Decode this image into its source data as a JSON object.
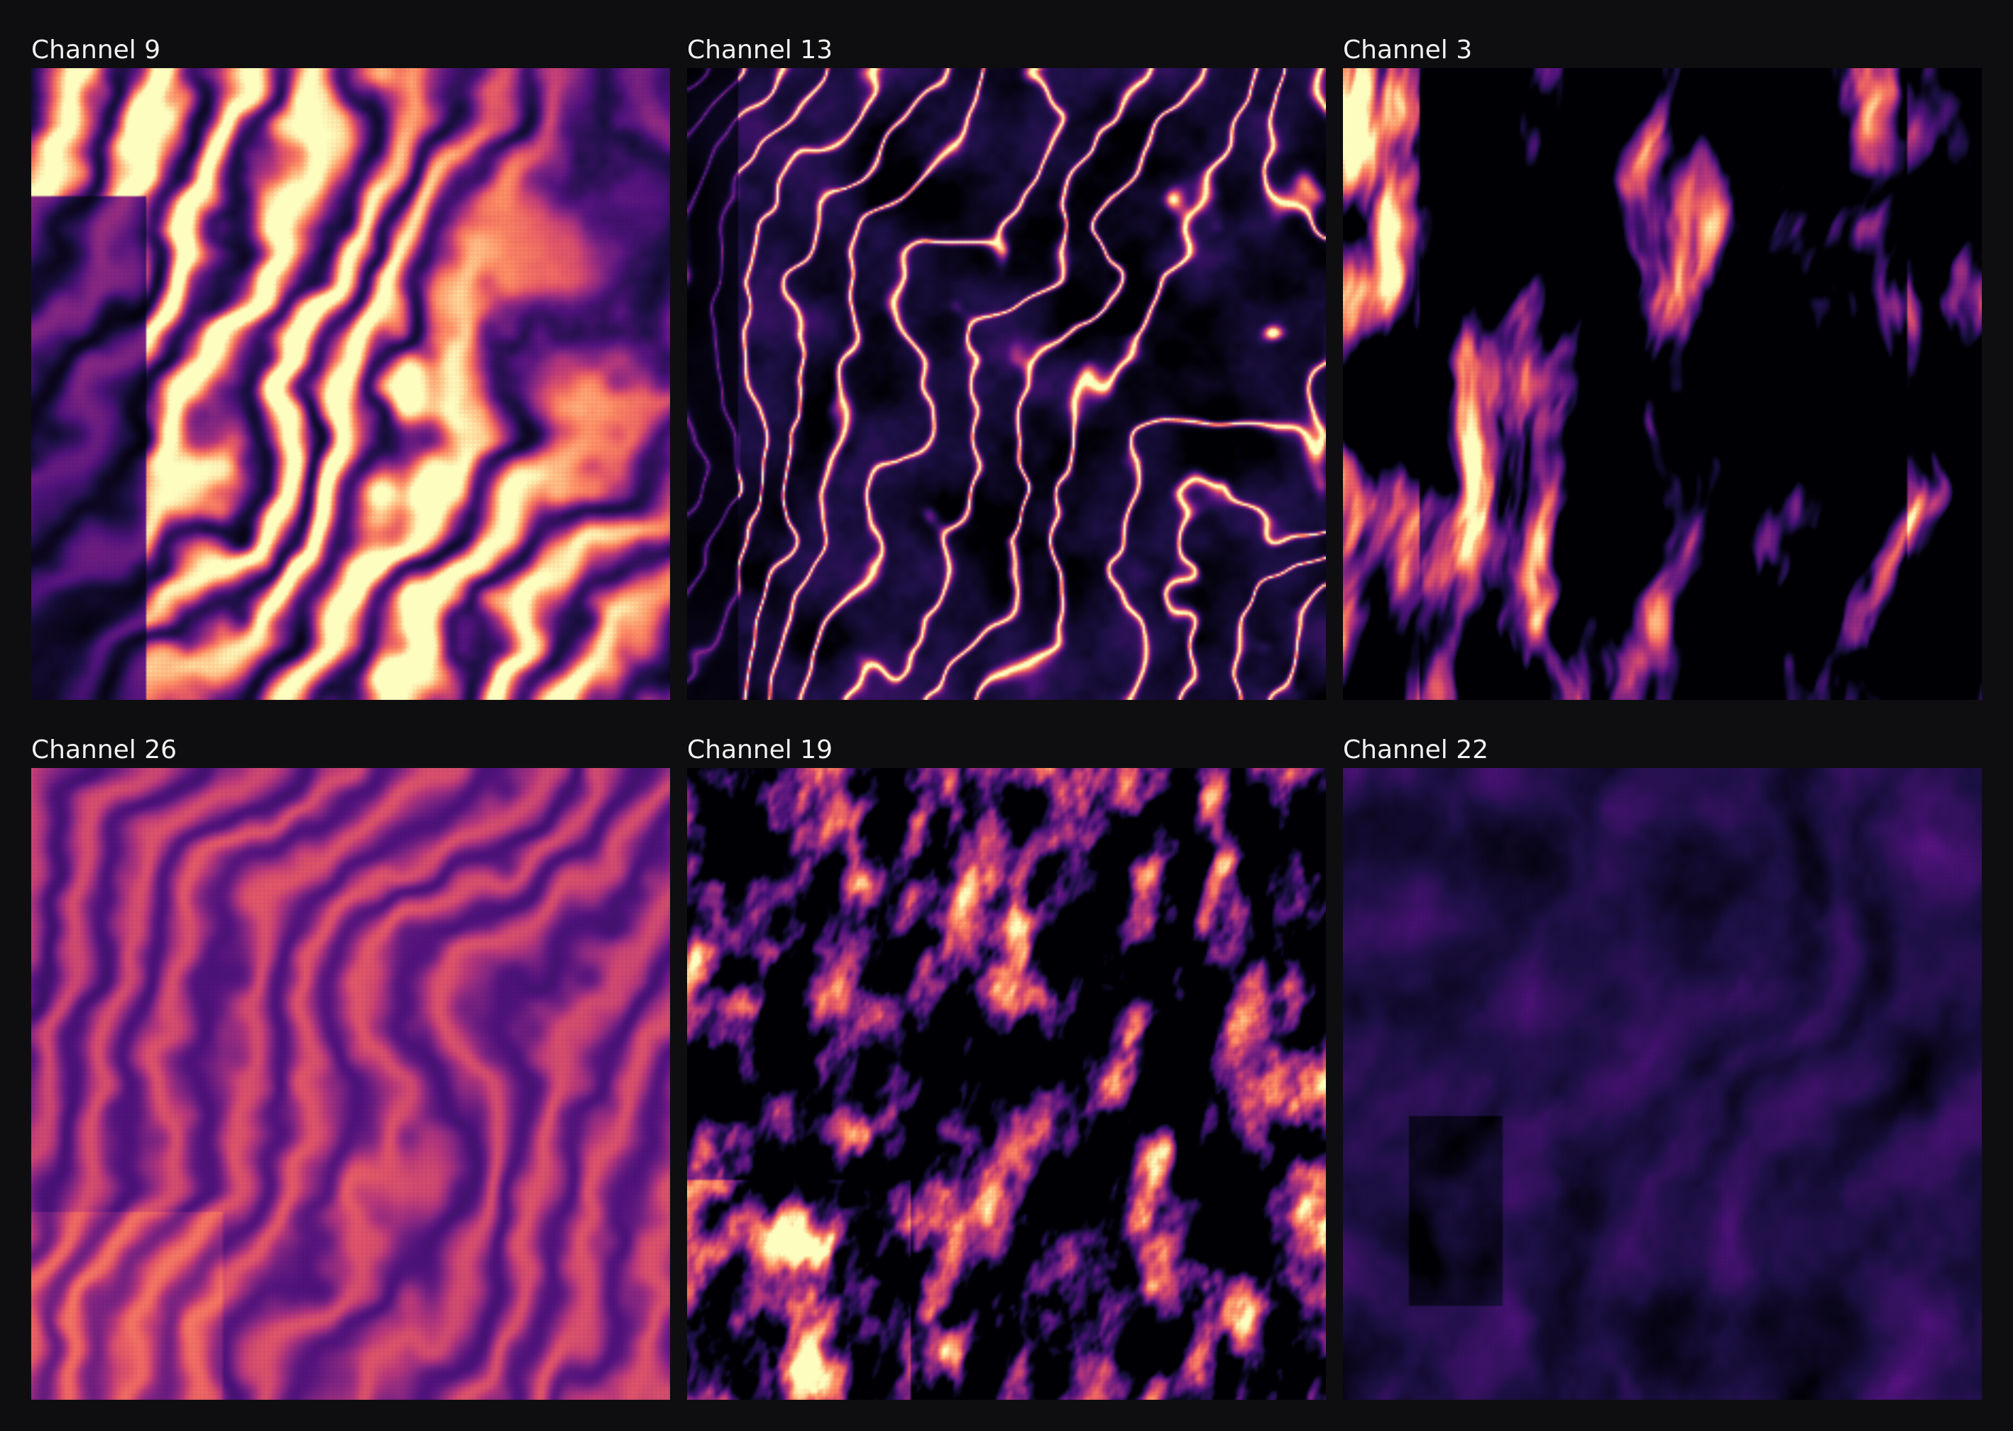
{
  "colormap": [
    "#000004",
    "#1c1044",
    "#4f127b",
    "#812581",
    "#b5367a",
    "#e55964",
    "#fb8761",
    "#fec287",
    "#fcfdbf"
  ],
  "panels": [
    {
      "title": "Channel 9",
      "pattern": "diagonal-bands",
      "intensity": 0.78,
      "contrast": 1.0
    },
    {
      "title": "Channel 13",
      "pattern": "thin-ridges",
      "intensity": 0.55,
      "contrast": 1.2
    },
    {
      "title": "Channel 3",
      "pattern": "sparse-blobs",
      "intensity": 0.45,
      "contrast": 1.6
    },
    {
      "title": "Channel 26",
      "pattern": "stripes",
      "intensity": 0.48,
      "contrast": 0.9
    },
    {
      "title": "Channel 19",
      "pattern": "speckle",
      "intensity": 0.35,
      "contrast": 1.5
    },
    {
      "title": "Channel 22",
      "pattern": "soft-texture",
      "intensity": 0.42,
      "contrast": 0.6
    }
  ]
}
